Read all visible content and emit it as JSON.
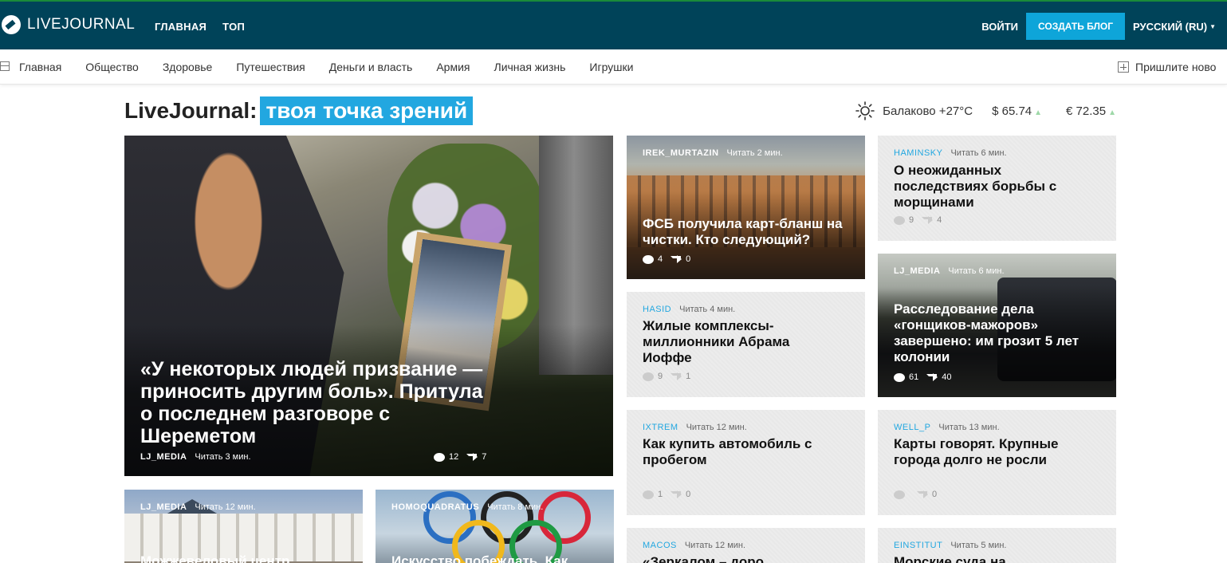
{
  "topbar": {
    "logo_text": "LIVEJOURNAL",
    "nav": [
      "ГЛАВНАЯ",
      "ТОП"
    ],
    "login": "ВОЙТИ",
    "create_blog": "СОЗДАТЬ БЛОГ",
    "language": "РУССКИЙ (RU)",
    "colors": {
      "bar": "#004359",
      "accent": "#0ea5d9"
    }
  },
  "categories": {
    "items": [
      "Главная",
      "Общество",
      "Здоровье",
      "Путешествия",
      "Деньги и власть",
      "Армия",
      "Личная жизнь",
      "Игрушки"
    ],
    "suggest": "Пришлите ново"
  },
  "header": {
    "brand": "LiveJournal:",
    "slogan": "твоя точка зрений",
    "weather": "Балаково +27°C",
    "usd": "$ 65.74",
    "eur": "€ 72.35"
  },
  "cards": [
    {
      "author": "LJ_MEDIA",
      "read": "Читать 3 мин.",
      "title": "«У некоторых людей призвание — приносить другим боль». Притула о последнем разговоре с Шереметом",
      "comments": "12",
      "shares": "7"
    },
    {
      "author": "IREK_MURTAZIN",
      "read": "Читать 2 мин.",
      "title": "ФСБ получила карт-бланш на чистки. Кто следующий?",
      "comments": "4",
      "shares": "0"
    },
    {
      "author": "HAMINSKY",
      "read": "Читать 6 мин.",
      "title": "О неожиданных последствиях борьбы с морщинами",
      "comments": "9",
      "shares": "4"
    },
    {
      "author": "HASID",
      "read": "Читать 4 мин.",
      "title": "Жилые комплексы-миллионники Абрама Иоффе",
      "comments": "9",
      "shares": "1"
    },
    {
      "author": "LJ_MEDIA",
      "read": "Читать 6 мин.",
      "title": "Расследование дела «гонщиков-мажоров» завершено: им грозит 5 лет колонии",
      "comments": "61",
      "shares": "40"
    },
    {
      "author": "IXTREM",
      "read": "Читать 12 мин.",
      "title": "Как купить автомобиль с пробегом",
      "comments": "1",
      "shares": "0"
    },
    {
      "author": "WELL_P",
      "read": "Читать 13 мин.",
      "title": "Карты говорят. Крупные города долго не росли",
      "comments": "",
      "shares": "0"
    },
    {
      "author": "LJ_MEDIA",
      "read": "Читать 12 мин.",
      "title": "Можжевеловый центр"
    },
    {
      "author": "HOMOQUADRATUS",
      "read": "Читать 8 мин.",
      "title": "Искусство побеждать. Как"
    },
    {
      "author": "MACOS",
      "read": "Читать 12 мин.",
      "title": "«Зеркалом – доро"
    },
    {
      "author": "EINSTITUT",
      "read": "Читать 5 мин.",
      "title": "Морские суда на"
    }
  ]
}
